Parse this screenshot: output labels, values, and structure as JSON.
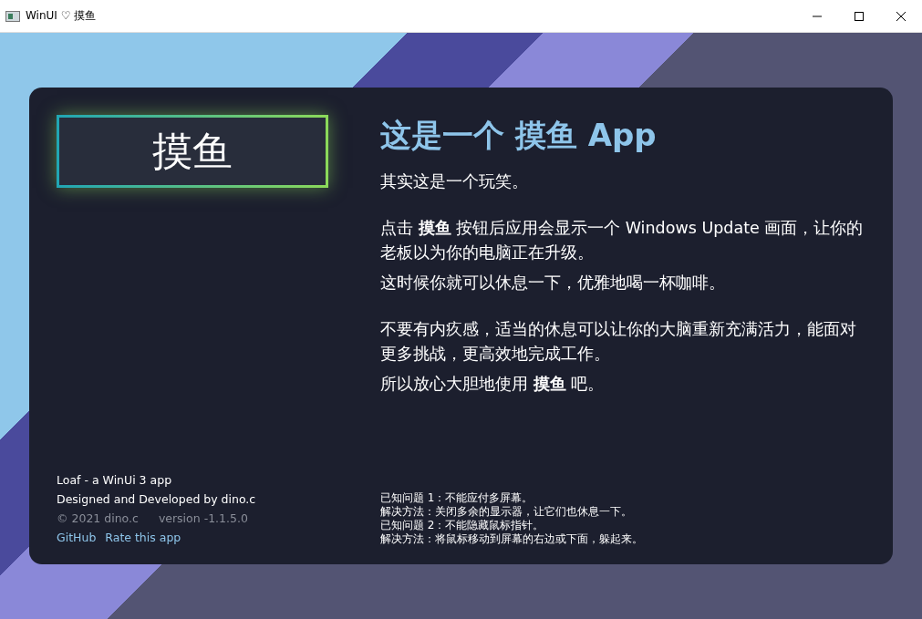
{
  "window": {
    "title": "WinUI ♡ 摸鱼"
  },
  "loaf_button": {
    "label": "摸鱼"
  },
  "about": {
    "name": "Loaf - a WinUi 3 app",
    "credit": "Designed and Developed by dino.c",
    "copyright": "© 2021 dino.c",
    "version": "version -1.1.5.0",
    "links": [
      "GitHub",
      "Rate this app"
    ]
  },
  "heading": "这是一个 摸鱼 App",
  "paragraph_groups": [
    [
      "其实这是一个玩笑。"
    ],
    [
      "点击 **摸鱼** 按钮后应用会显示一个 Windows Update 画面，让你的老板以为你的电脑正在升级。",
      "这时候你就可以休息一下，优雅地喝一杯咖啡。"
    ],
    [
      "不要有内疚感，适当的休息可以让你的大脑重新充满活力，能面对更多挑战，更高效地完成工作。",
      "所以放心大胆地使用 **摸鱼** 吧。"
    ]
  ],
  "known_issues": [
    "已知问题 1：不能应付多屏幕。",
    "解决方法：关闭多余的显示器，让它们也休息一下。",
    "已知问题 2：不能隐藏鼠标指针。",
    "解决方法：将鼠标移动到屏幕的右边或下面，躲起来。"
  ]
}
